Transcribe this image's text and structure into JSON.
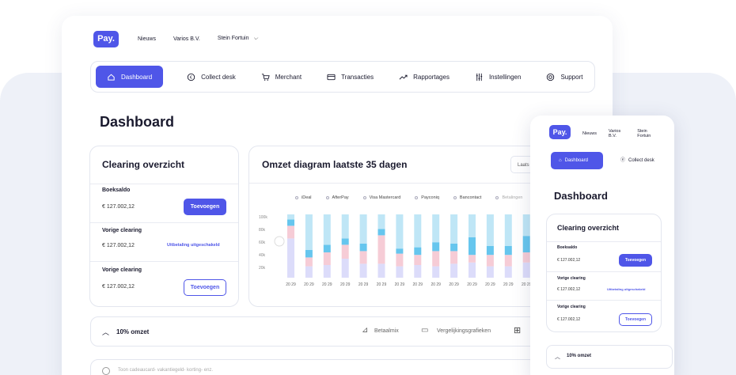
{
  "desktop": {
    "logo": "Pay.",
    "topnav": [
      "Nieuws",
      "Varios B.V.",
      "Stein Fortuin"
    ],
    "nav": [
      {
        "label": "Dashboard",
        "icon": "home-icon",
        "active": true
      },
      {
        "label": "Collect desk",
        "icon": "euro-icon"
      },
      {
        "label": "Merchant",
        "icon": "cart-icon"
      },
      {
        "label": "Transacties",
        "icon": "card-icon"
      },
      {
        "label": "Rapportages",
        "icon": "trend-icon"
      },
      {
        "label": "Instellingen",
        "icon": "sliders-icon"
      },
      {
        "label": "Support",
        "icon": "lifebuoy-icon"
      }
    ],
    "page_title": "Dashboard",
    "clearing": {
      "title": "Clearing overzicht",
      "rows": [
        {
          "label": "Boeksaldo",
          "value": "€ 127.002,12",
          "action": "Toevoegen",
          "style": "fill"
        },
        {
          "label": "Vorige clearing",
          "value": "€ 127.002,12",
          "action": "Uitbetaling uitgeschakeld",
          "style": "link"
        },
        {
          "label": "Vorige clearing",
          "value": "€ 127.002,12",
          "action": "Toevoegen",
          "style": "outline"
        }
      ]
    },
    "omzet": {
      "title": "Omzet diagram laatste 35 dagen",
      "select_value": "Laats"
    },
    "bottom": {
      "label": "10% omzet",
      "tools": [
        "Betaalmix",
        "Vergelijkingsgrafieken"
      ],
      "footer_hint": "Toon cadeaucard- vakantiegeld- korting- enz."
    }
  },
  "chart_data": {
    "type": "bar",
    "stacked": true,
    "legend": [
      "iDeal",
      "AfterPay",
      "Visa Mastercard",
      "Payconiq",
      "Bancontact",
      "Betalingen"
    ],
    "yticks": [
      "100k",
      "80k",
      "60k",
      "40k",
      "20k"
    ],
    "ylim": [
      0,
      100
    ],
    "categories": [
      "20 29",
      "20 29",
      "20 29",
      "20 29",
      "20 29",
      "20 29",
      "20 29",
      "20 29",
      "20 29",
      "20 29",
      "20 29",
      "20 29",
      "20 29",
      "20 29"
    ],
    "series": [
      {
        "values": [
          62,
          18,
          20,
          30,
          22,
          22,
          18,
          20,
          18,
          22,
          24,
          18,
          18,
          24
        ],
        "color": "#dcdcfa"
      },
      {
        "values": [
          20,
          14,
          20,
          22,
          20,
          45,
          20,
          16,
          24,
          20,
          12,
          18,
          18,
          16
        ],
        "color": "#f6ccd6"
      },
      {
        "values": [
          10,
          12,
          12,
          10,
          12,
          10,
          8,
          12,
          14,
          12,
          28,
          14,
          14,
          26
        ],
        "color": "#66c6ee"
      },
      {
        "values": [
          8,
          56,
          48,
          38,
          46,
          23,
          54,
          52,
          44,
          46,
          36,
          50,
          50,
          34
        ],
        "color": "#bfe6f6"
      }
    ],
    "colors": {
      "accent": "#4f56e8",
      "ideal": "#dcdcfa",
      "afterpay": "#f6ccd6",
      "visa": "#66c6ee",
      "light": "#bfe6f6"
    }
  },
  "mobile": {
    "logo": "Pay.",
    "topnav": [
      "Nieuws",
      "Varios B.V.",
      "Stein Fortuin"
    ],
    "nav": [
      {
        "label": "Dashboard",
        "icon": "home-icon",
        "active": true
      },
      {
        "label": "Collect desk",
        "icon": "euro-icon"
      }
    ],
    "page_title": "Dashboard",
    "clearing": {
      "title": "Clearing overzicht",
      "rows": [
        {
          "label": "Boeksaldo",
          "value": "€ 127.002,12",
          "action": "Toevoegen"
        },
        {
          "label": "Vorige clearing",
          "value": "€ 127.002,12",
          "action": "Uitbetaling uitgeschakeld"
        },
        {
          "label": "Vorige clearing",
          "value": "€ 127.002,12",
          "action": "Toevoegen"
        }
      ]
    },
    "bottom_label": "10% omzet"
  }
}
